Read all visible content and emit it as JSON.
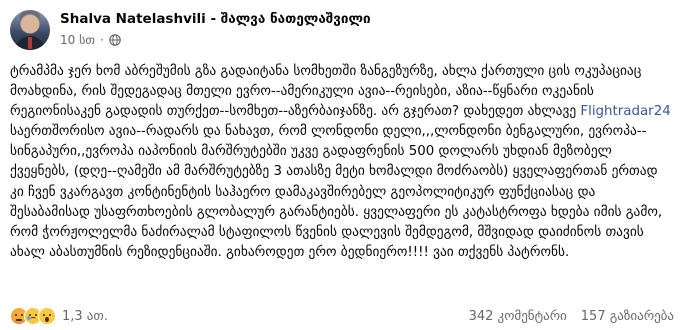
{
  "post": {
    "author": "Shalva Natelashvili - შალვა ნათელაშვილი",
    "time": "10 სთ",
    "separator": "·",
    "privacy_icon": "globe-icon",
    "body_before_link": "ტრამპმა ჯერ ხომ აბრეშუმის გზა გადაიტანა სომხეთში ზანგეზურზე, ახლა ქართული ცის ოკუპაციაც მოახდინა, რის შედეგადაც მთელი ევრო--ამერიკული ავია--რეისები, აზია--წყნარი ოკეანის რეგიონისაკენ გადადის თურქეთ--სომხეთ--აზერბაიჯანზე. არ გჯერათ? დახედეთ ახლავე ",
    "link_text": "Flightradar24",
    "body_after_link": " საერთშორისო ავია--რადარს და ნახავთ, რომ ლონდონი დელი,,,ლონდონი ბენგალური, ევროპა--სინგაპური,,ევროპა იაპონიის მარშრუტებში უკვე გადაფრენის 500 დოლარს უხდიან მეზობელ ქვეყნებს, (დღე--ღამეში ამ მარშრუტებზე 3 ათასზე მეტი ხომალდი მოძრაობს) ყველაფერთან ერთად კი ჩვენ ვკარგავთ კონტინენტის საჰაერო დამაკავშირებელ გეოპოლიტიკურ ფუნქციასაც და შესაბამისად უსაფრთხოების გლობალურ გარანტიებს. ყველაფერი ეს კატასტროფა ხდება იმის გამო, რომ ჭორჟოლელმა ნაძირალამ სტაფილოს წვენის დალევის შემდეგომ, მშვიდად დაიძინოს თავის ახალ აბასთუმნის რეზიდენციაში. გიხაროდეთ ერო ბედნიერო!!!! ვაი თქვენს პატრონს."
  },
  "reactions": {
    "emojis": [
      "angry-emoji",
      "sad-emoji",
      "wow-emoji"
    ],
    "count": "1,3 ათ.",
    "comments": "342 კომენტარი",
    "shares": "157 გაზიარება"
  },
  "colors": {
    "link": "#385898",
    "muted": "#65686c",
    "text": "#080809"
  }
}
